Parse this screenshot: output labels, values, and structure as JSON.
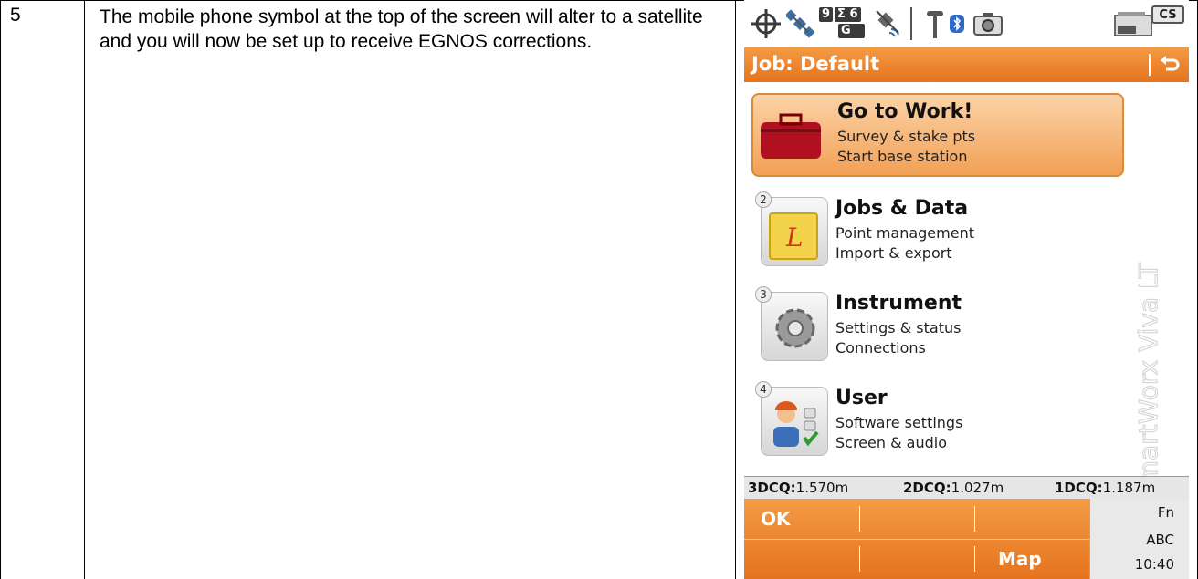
{
  "step": {
    "number": "5",
    "text": "The mobile phone symbol at the top of the screen will alter to a satellite and you will now be set up to receive EGNOS corrections."
  },
  "device": {
    "status": {
      "sat_counts": {
        "gps_top": "9",
        "sigma_top": "Σ 6",
        "glonass_bottom": "G 6"
      },
      "cs_label": "CS"
    },
    "titlebar": {
      "title": "Job: Default"
    },
    "menu": [
      {
        "badge": "",
        "title": "Go to Work!",
        "line1": "Survey & stake pts",
        "line2": "Start base station"
      },
      {
        "badge": "2",
        "title": "Jobs & Data",
        "line1": "Point management",
        "line2": "Import & export"
      },
      {
        "badge": "3",
        "title": "Instrument",
        "line1": "Settings & status",
        "line2": "Connections"
      },
      {
        "badge": "4",
        "title": "User",
        "line1": "Software settings",
        "line2": "Screen & audio"
      }
    ],
    "watermark": "SmartWorx Viva LT",
    "dcq": {
      "k1": "3DCQ:",
      "v1": "1.570m",
      "k2": "2DCQ:",
      "v2": "1.027m",
      "k3": "1DCQ:",
      "v3": "1.187m"
    },
    "softkeys": {
      "ok": "OK",
      "map": "Map"
    },
    "side": {
      "fn": "Fn",
      "abc": "ABC",
      "time": "10:40"
    }
  }
}
